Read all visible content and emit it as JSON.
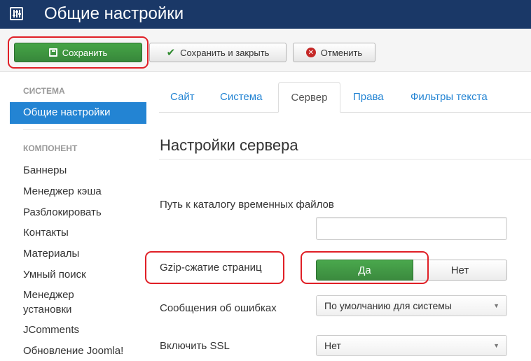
{
  "header": {
    "title": "Общие настройки",
    "icon": "settings-sliders-icon"
  },
  "toolbar": {
    "save_label": "Сохранить",
    "save_close_label": "Сохранить и закрыть",
    "cancel_label": "Отменить",
    "save_color": "#46a546",
    "cancel_icon_color": "#c52827"
  },
  "sidebar": {
    "system_heading": "СИСТЕМА",
    "active_item": "Общие настройки",
    "component_heading": "КОМПОНЕНТ",
    "items": [
      "Баннеры",
      "Менеджер кэша",
      "Разблокировать",
      "Контакты",
      "Материалы",
      "Умный поиск",
      "Менеджер",
      "установки",
      "JComments",
      "Обновление Joomla!"
    ]
  },
  "tabs": [
    {
      "label": "Сайт",
      "active": false
    },
    {
      "label": "Система",
      "active": false
    },
    {
      "label": "Сервер",
      "active": true
    },
    {
      "label": "Права",
      "active": false
    },
    {
      "label": "Фильтры текста",
      "active": false
    }
  ],
  "server": {
    "legend": "Настройки сервера",
    "tmp_path_label": "Путь к каталогу временных файлов",
    "tmp_path_value": "",
    "gzip_label": "Gzip-сжатие страниц",
    "gzip_yes": "Да",
    "gzip_no": "Нет",
    "gzip_selected": "Да",
    "errors_label": "Сообщения об ошибках",
    "errors_value": "По умолчанию для системы",
    "ssl_label": "Включить SSL",
    "ssl_value": "Нет"
  },
  "colors": {
    "header_bg": "#1a3867",
    "accent_blue": "#2384d3",
    "highlight_red": "#e01f26"
  }
}
